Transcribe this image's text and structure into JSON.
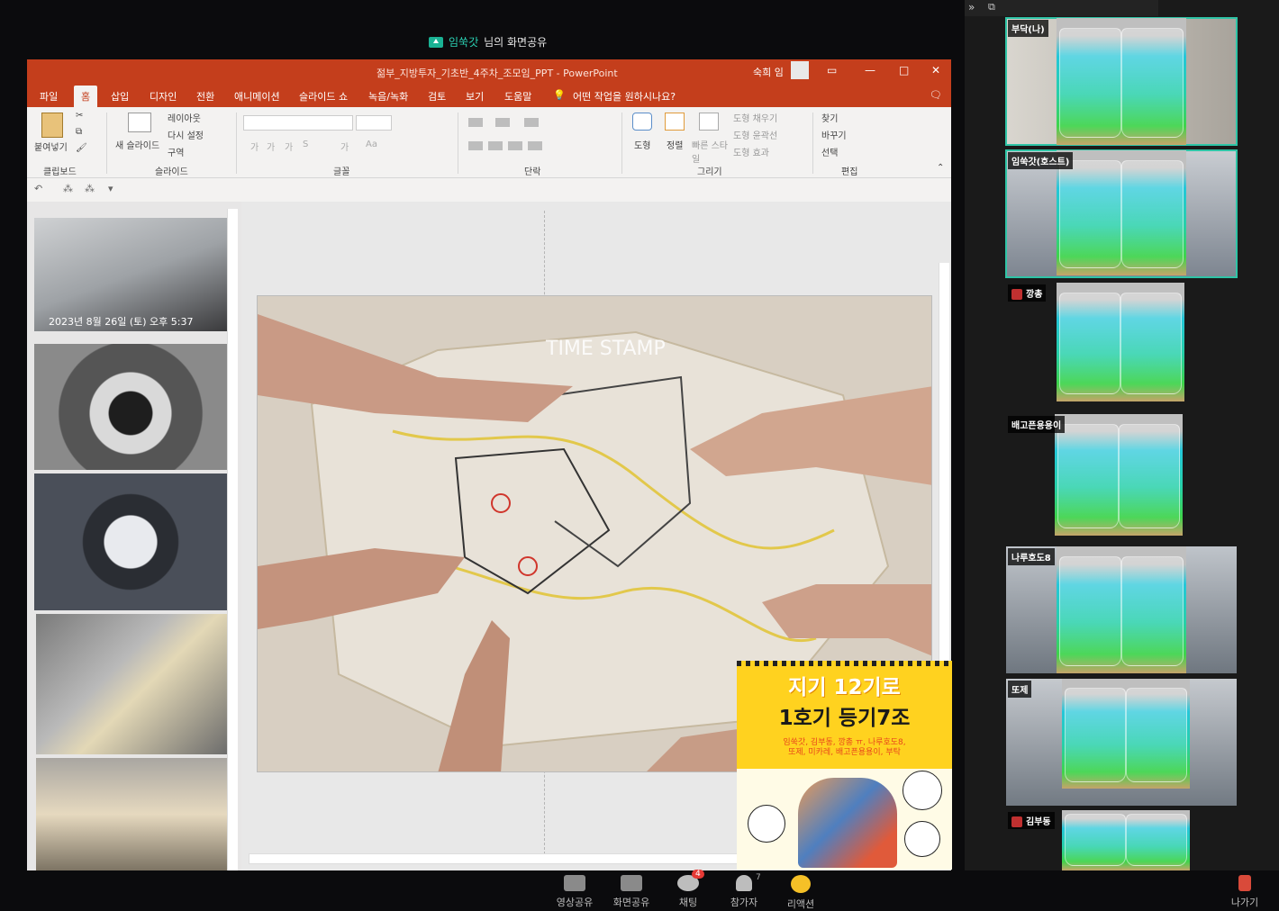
{
  "share_banner": {
    "host": "임쑥갓",
    "suffix": "님의 화면공유"
  },
  "ppt": {
    "doc_title": "젊부_지방투자_기초반_4주차_조모임_PPT - PowerPoint",
    "user": "숙희 임",
    "tabs": [
      "파일",
      "홈",
      "삽입",
      "디자인",
      "전환",
      "애니메이션",
      "슬라이드 쇼",
      "녹음/녹화",
      "검토",
      "보기",
      "도움말"
    ],
    "tell_me": "어떤 작업을 원하시나요?",
    "ribbon": {
      "paste": "붙여넣기",
      "clipboard": "클립보드",
      "new_slide": "새 슬라이드",
      "layout": "레이아웃",
      "reset": "다시 설정",
      "section": "구역",
      "slides": "슬라이드",
      "font": "글꼴",
      "paragraph": "단락",
      "shape": "도형",
      "arrange": "정렬",
      "quick_styles": "빠른 스타일",
      "shape_fill": "도형 채우기",
      "shape_outline": "도형 윤곽선",
      "shape_effects": "도형 효과",
      "drawing": "그리기",
      "find": "찾기",
      "replace": "바꾸기",
      "select": "선택",
      "editing": "편집",
      "font_size_glyphs": [
        "가",
        "가",
        "가",
        "S",
        "가",
        "가",
        "Aa",
        "가",
        "가"
      ]
    },
    "thumb_caption": "2023년 8월 26일 (토) 오후 5:37",
    "slide_watermark": "TIME STAMP"
  },
  "poster": {
    "line1": "지기 12기로",
    "line2": "1호기 등기7조",
    "line3": "임쑥갓, 김부동, 깡총 ㅠ, 나루호도8,",
    "line4": "또제, 미카레, 배고픈용용이, 부탁"
  },
  "participants": [
    {
      "name": "부닥(나)",
      "muted": false,
      "active": true
    },
    {
      "name": "임쑥갓(호스트)",
      "muted": false,
      "active": true
    },
    {
      "name": "깡총",
      "muted": true,
      "active": false
    },
    {
      "name": "배고픈용용이",
      "muted": false,
      "active": false
    },
    {
      "name": "나루호도8",
      "muted": false,
      "active": false
    },
    {
      "name": "또제",
      "muted": false,
      "active": false
    },
    {
      "name": "김부동",
      "muted": true,
      "active": false
    }
  ],
  "toolbar": {
    "video_share": "영상공유",
    "screen_share": "화면공유",
    "chat": "채팅",
    "chat_badge": "4",
    "participants": "참가자",
    "participants_count": "7",
    "reaction": "리액션",
    "leave": "나가기"
  },
  "colors": {
    "ppt_red": "#c43e1c",
    "active_tile": "#2ec4a6",
    "poster_yellow": "#ffd21f",
    "drink_teal": "#26d0a9"
  }
}
